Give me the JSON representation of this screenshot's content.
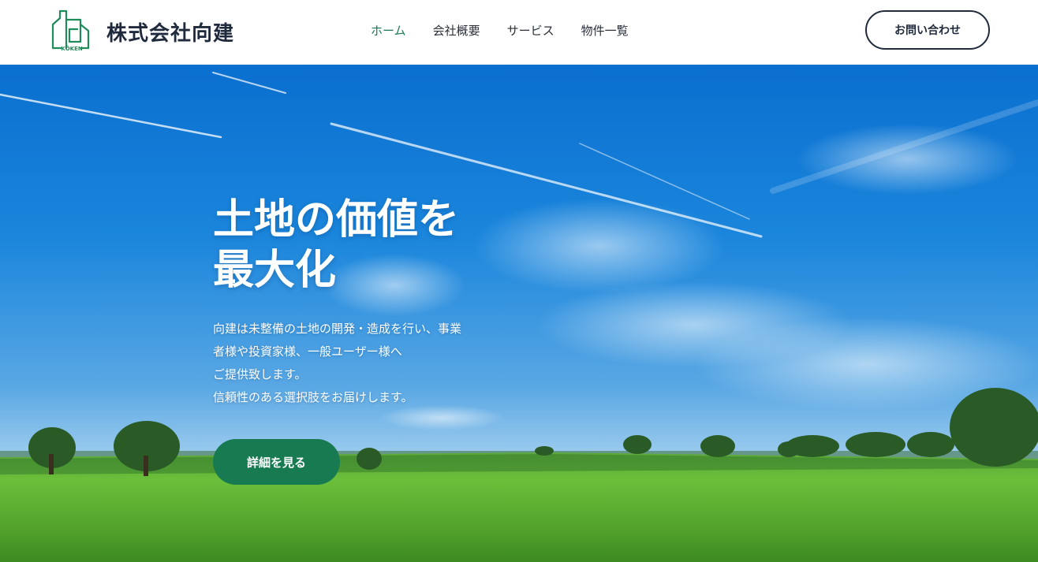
{
  "brand": {
    "company_name": "株式会社向建",
    "logo_text": "KŌKEN",
    "logo_color": "#1f8a5a"
  },
  "nav": {
    "items": [
      {
        "label": "ホーム",
        "active": true
      },
      {
        "label": "会社概要",
        "active": false
      },
      {
        "label": "サービス",
        "active": false
      },
      {
        "label": "物件一覧",
        "active": false
      }
    ],
    "active_color": "#1b7a52"
  },
  "header": {
    "contact_label": "お問い合わせ"
  },
  "hero": {
    "title_lines": [
      "土地の価値を",
      "最大化"
    ],
    "description_lines": [
      "向建は未整備の土地の開発・造成を行い、事業",
      "者様や投資家様、一般ユーザー様へ",
      "ご提供致します。",
      "信頼性のある選択肢をお届けします。"
    ],
    "cta_label": "詳細を見る",
    "cta_color": "#177a50"
  }
}
